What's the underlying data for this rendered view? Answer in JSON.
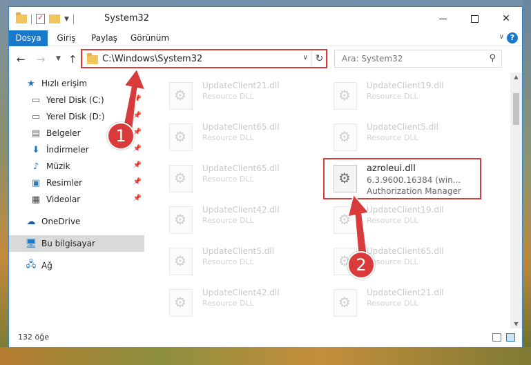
{
  "window": {
    "title": "System32",
    "status_count": "132 öğe"
  },
  "ribbon": {
    "tabs": [
      {
        "label": "Dosya",
        "active": true
      },
      {
        "label": "Giriş"
      },
      {
        "label": "Paylaş"
      },
      {
        "label": "Görünüm"
      }
    ],
    "help": "?"
  },
  "address": {
    "path": "C:\\Windows\\System32"
  },
  "search": {
    "placeholder": "Ara: System32"
  },
  "sidebar": {
    "items": [
      {
        "label": "Hızlı erişim",
        "icon": "star-icon"
      },
      {
        "label": "Yerel Disk (C:)",
        "icon": "drive-icon",
        "pinned": true
      },
      {
        "label": "Yerel Disk (D:)",
        "icon": "drive-icon",
        "pinned": true
      },
      {
        "label": "Belgeler",
        "icon": "documents-icon",
        "pinned": true
      },
      {
        "label": "İndirmeler",
        "icon": "download-icon",
        "pinned": true
      },
      {
        "label": "Müzik",
        "icon": "music-icon",
        "pinned": true
      },
      {
        "label": "Resimler",
        "icon": "pictures-icon",
        "pinned": true
      },
      {
        "label": "Videolar",
        "icon": "video-icon",
        "pinned": true
      },
      {
        "label": "OneDrive",
        "icon": "cloud-icon"
      },
      {
        "label": "Bu bilgisayar",
        "icon": "computer-icon",
        "selected": true
      },
      {
        "label": "Ağ",
        "icon": "network-icon"
      }
    ]
  },
  "files": {
    "faded_type": "Resource DLL",
    "left_column": [
      "UpdateClient21.dll",
      "UpdateClient65.dll",
      "UpdateClient65.dll",
      "UpdateClient42.dll",
      "UpdateClient5.dll",
      "UpdateClient42.dll"
    ],
    "right_column": [
      "UpdateClient19.dll",
      "UpdateClient5.dll",
      null,
      "UpdateClient19.dll",
      "UpdateClient65.dll",
      "UpdateClient21.dll"
    ],
    "highlighted": {
      "name": "azroleui.dll",
      "version": "6.3.9600.16384 (win...",
      "description": "Authorization Manager"
    }
  },
  "callouts": {
    "step1": "1",
    "step2": "2",
    "color": "#d93b3b"
  }
}
